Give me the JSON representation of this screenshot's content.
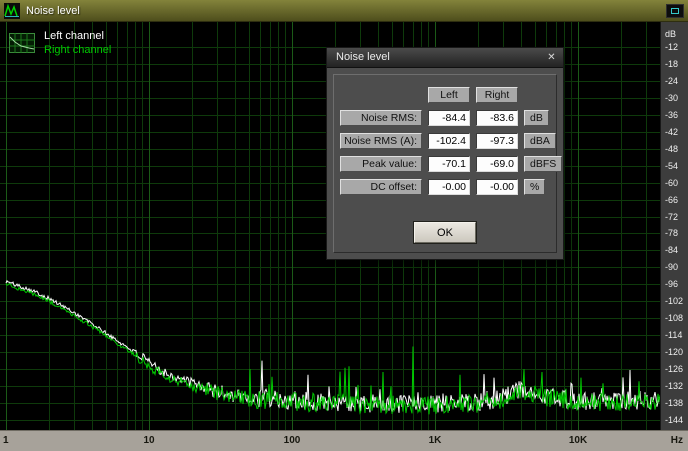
{
  "window": {
    "title": "Noise level"
  },
  "dialog": {
    "title": "Noise level",
    "close_icon": "✕",
    "columns": [
      "Left",
      "Right"
    ],
    "rows": [
      {
        "label": "Noise RMS:",
        "left": "-84.4",
        "right": "-83.6",
        "unit": "dB"
      },
      {
        "label": "Noise RMS (A):",
        "left": "-102.4",
        "right": "-97.3",
        "unit": "dBA"
      },
      {
        "label": "Peak value:",
        "left": "-70.1",
        "right": "-69.0",
        "unit": "dBFS"
      },
      {
        "label": "DC offset:",
        "left": "-0.00",
        "right": "-0.00",
        "unit": "%"
      }
    ],
    "ok": "OK"
  },
  "chart_data": {
    "type": "line",
    "title": "",
    "x_scale": "log",
    "x_unit": "Hz",
    "y_unit": "dB",
    "x_range_hz": [
      1,
      22050
    ],
    "ylim": [
      -144,
      -12
    ],
    "grid": true,
    "grid_color": "#0e3a0b",
    "grid_major_color": "#1b5a17",
    "x_ticks": [
      {
        "label": "1",
        "f": 1
      },
      {
        "label": "10",
        "f": 10
      },
      {
        "label": "100",
        "f": 100
      },
      {
        "label": "1K",
        "f": 1000
      },
      {
        "label": "10K",
        "f": 10000
      }
    ],
    "y_ticks": [
      -12,
      -18,
      -24,
      -30,
      -36,
      -42,
      -48,
      -54,
      -60,
      -66,
      -72,
      -78,
      -84,
      -90,
      -96,
      -102,
      -108,
      -114,
      -120,
      -126,
      -132,
      -138,
      -144
    ],
    "series": [
      {
        "name": "Left channel",
        "color": "#ffffff",
        "envelope": [
          [
            1,
            -95
          ],
          [
            1.5,
            -98
          ],
          [
            2,
            -101
          ],
          [
            3,
            -106
          ],
          [
            4,
            -110
          ],
          [
            6,
            -116
          ],
          [
            8,
            -120
          ],
          [
            10,
            -124
          ],
          [
            14,
            -128
          ],
          [
            20,
            -131
          ],
          [
            30,
            -134
          ],
          [
            50,
            -136
          ],
          [
            100,
            -137
          ],
          [
            300,
            -138
          ],
          [
            1000,
            -138.5
          ],
          [
            2500,
            -137.5
          ],
          [
            4000,
            -133
          ],
          [
            6000,
            -135.5
          ],
          [
            10000,
            -137.5
          ],
          [
            22050,
            -137
          ]
        ],
        "spikes": [
          [
            62,
            -123
          ],
          [
            130,
            -128
          ],
          [
            2600,
            -129
          ],
          [
            9000,
            -131
          ]
        ],
        "spike_extra": 9
      },
      {
        "name": "Right channel",
        "color": "#00c800",
        "envelope": [
          [
            1,
            -96
          ],
          [
            1.5,
            -99
          ],
          [
            2,
            -102
          ],
          [
            3,
            -107
          ],
          [
            4,
            -111
          ],
          [
            6,
            -117
          ],
          [
            8,
            -121
          ],
          [
            10,
            -125
          ],
          [
            14,
            -129
          ],
          [
            20,
            -132
          ],
          [
            30,
            -134.5
          ],
          [
            50,
            -136.5
          ],
          [
            100,
            -137.5
          ],
          [
            300,
            -138.5
          ],
          [
            1000,
            -139
          ],
          [
            2500,
            -138
          ],
          [
            4000,
            -133.5
          ],
          [
            6000,
            -136
          ],
          [
            10000,
            -138
          ],
          [
            22050,
            -137.5
          ]
        ],
        "spikes": [
          [
            250,
            -125
          ],
          [
            430,
            -127
          ],
          [
            700,
            -118
          ],
          [
            1500,
            -128
          ],
          [
            4200,
            -126
          ],
          [
            5600,
            -127
          ],
          [
            10500,
            -129
          ],
          [
            15000,
            -131
          ]
        ],
        "spike_extra": 14
      }
    ]
  }
}
